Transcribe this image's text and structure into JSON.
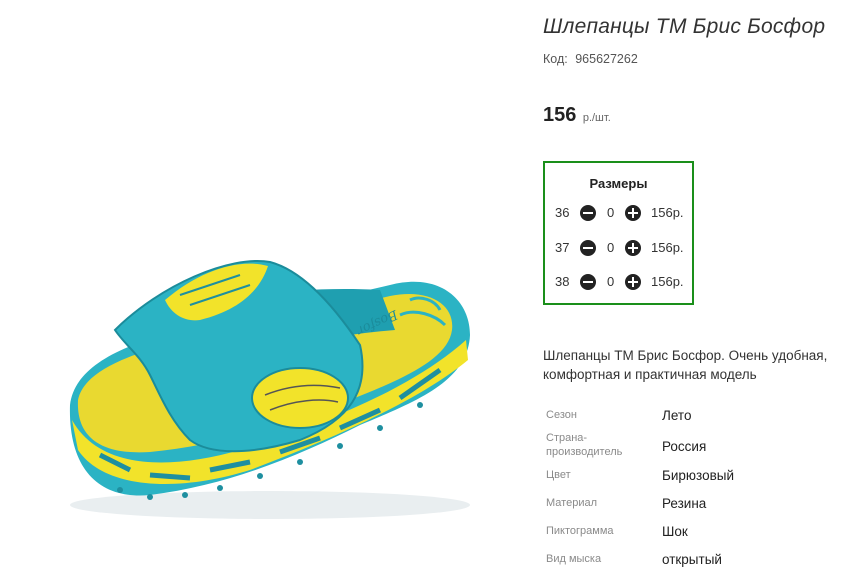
{
  "product": {
    "title": "Шлепанцы ТМ Брис Босфор",
    "code_label": "Код:",
    "code_value": "965627262",
    "price_value": "156",
    "price_unit": "р./шт.",
    "image_brand_text": "Bosfor"
  },
  "sizes": {
    "title": "Размеры",
    "rows": [
      {
        "size": "36",
        "qty": "0",
        "price": "156р."
      },
      {
        "size": "37",
        "qty": "0",
        "price": "156р."
      },
      {
        "size": "38",
        "qty": "0",
        "price": "156р."
      }
    ]
  },
  "description": "Шлепанцы ТМ Брис Босфор. Очень удобная, комфортная и практичная модель",
  "properties": [
    {
      "key": "Сезон",
      "value": "Лето"
    },
    {
      "key": "Страна-производитель",
      "value": "Россия"
    },
    {
      "key": "Цвет",
      "value": "Бирюзовый"
    },
    {
      "key": "Материал",
      "value": "Резина"
    },
    {
      "key": "Пиктограмма",
      "value": "Шок"
    },
    {
      "key": "Вид мыска",
      "value": "открытый"
    }
  ],
  "colors": {
    "accent_border": "#1a8f1a",
    "product_teal": "#2bb3c4",
    "product_yellow": "#f2e32a"
  }
}
